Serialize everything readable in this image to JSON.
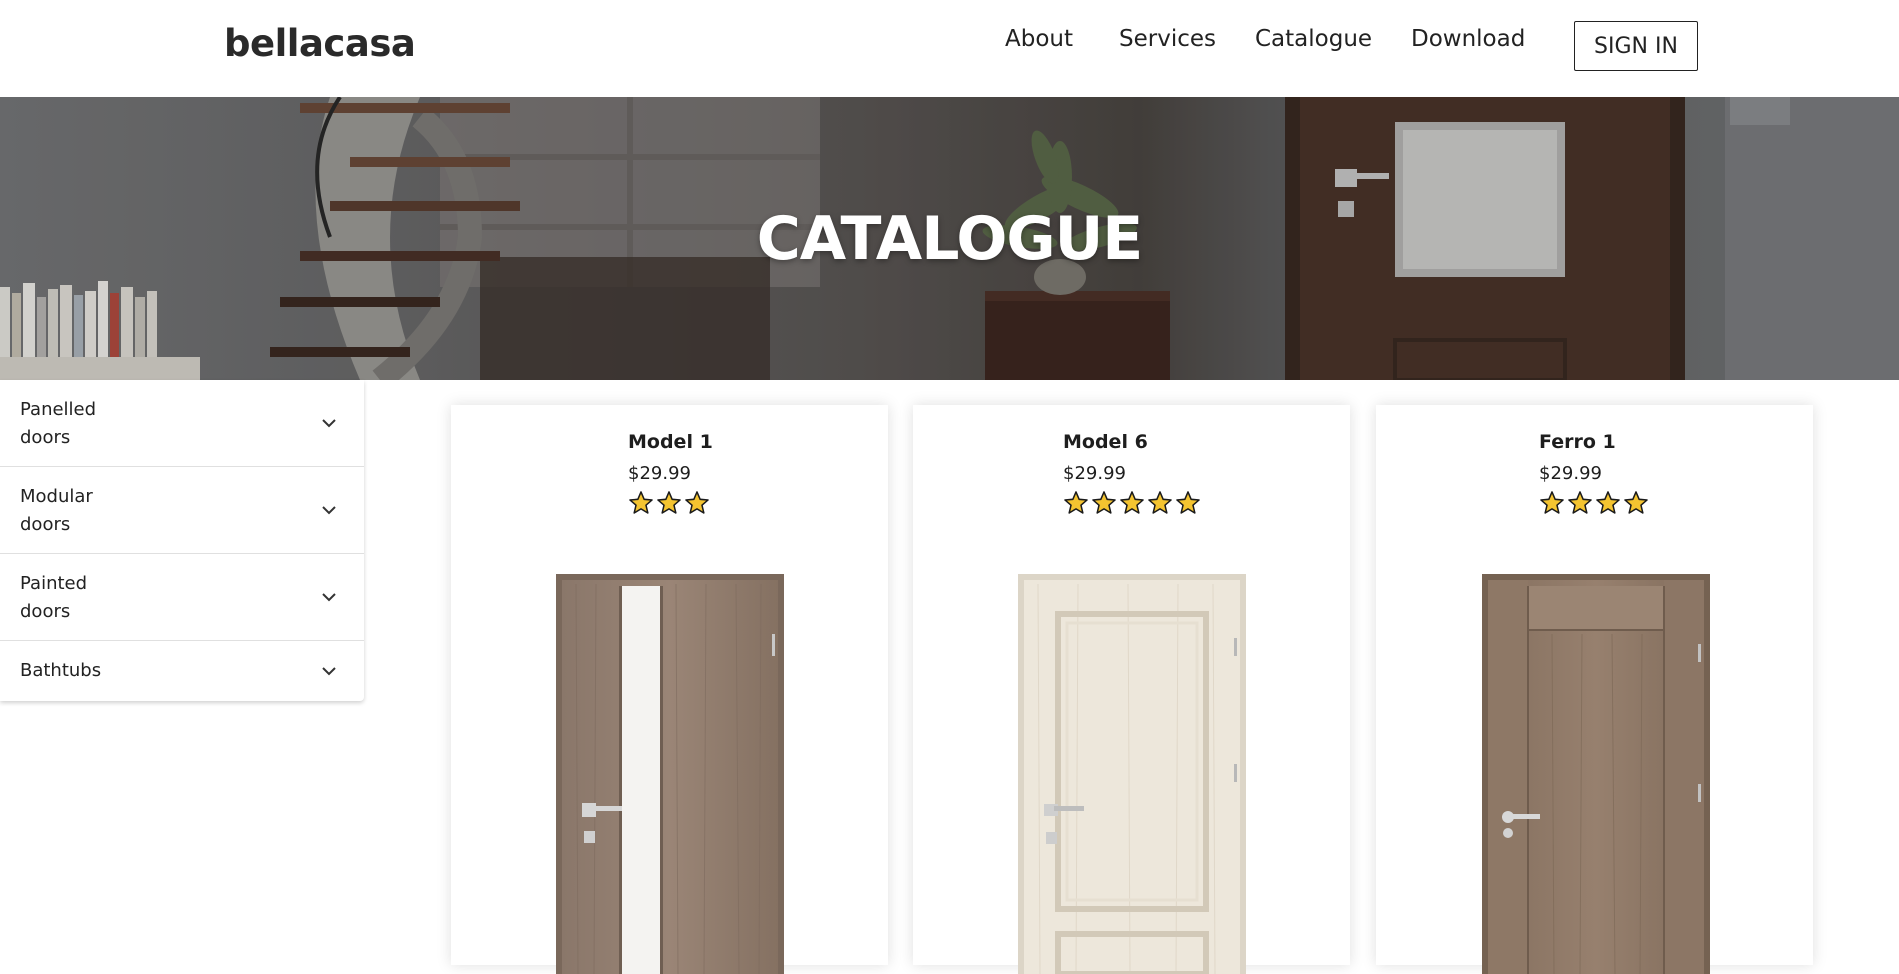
{
  "header": {
    "brand": "bellacasa",
    "nav": [
      "About",
      "Services",
      "Catalogue",
      "Download"
    ],
    "signin": "SIGN IN"
  },
  "hero": {
    "title": "CATALOGUE"
  },
  "sidebar": {
    "items": [
      {
        "line1": "Panelled",
        "line2": "doors"
      },
      {
        "line1": "Modular",
        "line2": "doors"
      },
      {
        "line1": "Painted",
        "line2": "doors"
      },
      {
        "line1": "Bathtubs",
        "line2": ""
      }
    ]
  },
  "products": [
    {
      "name": "Model 1",
      "price": "$29.99",
      "rating": 3,
      "finish": "oak-grey"
    },
    {
      "name": "Model 6",
      "price": "$29.99",
      "rating": 5,
      "finish": "white-pine"
    },
    {
      "name": "Ferro 1",
      "price": "$29.99",
      "rating": 4,
      "finish": "oak-grey"
    }
  ],
  "colors": {
    "star_fill": "#f4c430",
    "star_stroke": "#1b1b1b",
    "door_oak": "#8b7868",
    "door_white": "#ece6da"
  }
}
